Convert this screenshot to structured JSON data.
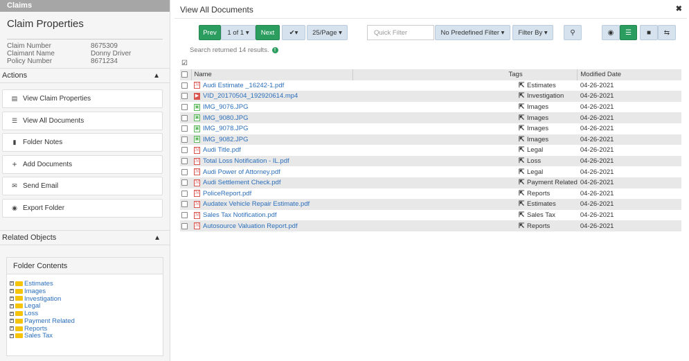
{
  "sidebar": {
    "header": "Claims",
    "claim_title": "Claim Properties",
    "claim_info": [
      {
        "label": "Claim Number",
        "value": "8675309"
      },
      {
        "label": "Claimant Name",
        "value": "Donny Driver"
      },
      {
        "label": "Policy Number",
        "value": "8671234"
      }
    ],
    "actions_title": "Actions",
    "actions": [
      {
        "label": "View Claim Properties",
        "icon": "list-box-icon"
      },
      {
        "label": "View All Documents",
        "icon": "list-icon"
      },
      {
        "label": "Folder Notes",
        "icon": "comment-icon"
      },
      {
        "label": "Add Documents",
        "icon": "plus-icon"
      },
      {
        "label": "Send Email",
        "icon": "envelope-icon"
      },
      {
        "label": "Export Folder",
        "icon": "export-icon"
      }
    ],
    "related_title": "Related Objects",
    "folder_contents_title": "Folder Contents",
    "folders": [
      "Estimates",
      "Images",
      "Investigation",
      "Legal",
      "Loss",
      "Payment Related",
      "Reports",
      "Sales Tax"
    ]
  },
  "main": {
    "title": "View All Documents",
    "toolbar": {
      "prev": "Prev",
      "page": "1 of 1 ▾",
      "next": "Next",
      "check": "✔▾",
      "per_page": "25/Page ▾",
      "quick_filter_placeholder": "Quick Filter",
      "predefined_filter": "No Predefined Filter ▾",
      "filter_by": "Filter By ▾"
    },
    "search_result": "Search returned 14 results.",
    "columns": {
      "name": "Name",
      "tags": "Tags",
      "modified": "Modified Date"
    },
    "documents": [
      {
        "name": "Audi Estimate _16242-1.pdf",
        "type": "pdf",
        "tag": "Estimates",
        "date": "04-26-2021"
      },
      {
        "name": "VID_20170504_192920614.mp4",
        "type": "vid",
        "tag": "Investigation",
        "date": "04-26-2021"
      },
      {
        "name": "IMG_9076.JPG",
        "type": "img",
        "tag": "Images",
        "date": "04-26-2021"
      },
      {
        "name": "IMG_9080.JPG",
        "type": "img",
        "tag": "Images",
        "date": "04-26-2021"
      },
      {
        "name": "IMG_9078.JPG",
        "type": "img",
        "tag": "Images",
        "date": "04-26-2021"
      },
      {
        "name": "IMG_9082.JPG",
        "type": "img",
        "tag": "Images",
        "date": "04-26-2021"
      },
      {
        "name": "Audi Title.pdf",
        "type": "pdf",
        "tag": "Legal",
        "date": "04-26-2021"
      },
      {
        "name": "Total Loss Notification - IL.pdf",
        "type": "pdf",
        "tag": "Loss",
        "date": "04-26-2021"
      },
      {
        "name": "Audi Power of Attorney.pdf",
        "type": "pdf",
        "tag": "Legal",
        "date": "04-26-2021"
      },
      {
        "name": "Audi Settlement Check.pdf",
        "type": "pdf",
        "tag": "Payment Related",
        "date": "04-26-2021"
      },
      {
        "name": "PoliceReport.pdf",
        "type": "pdf",
        "tag": "Reports",
        "date": "04-26-2021"
      },
      {
        "name": "Audatex Vehicle Repair Estimate.pdf",
        "type": "pdf",
        "tag": "Estimates",
        "date": "04-26-2021"
      },
      {
        "name": "Sales Tax Notification.pdf",
        "type": "pdf",
        "tag": "Sales Tax",
        "date": "04-26-2021"
      },
      {
        "name": "Autosource Valuation Report.pdf",
        "type": "pdf",
        "tag": "Reports",
        "date": "04-26-2021"
      }
    ]
  }
}
